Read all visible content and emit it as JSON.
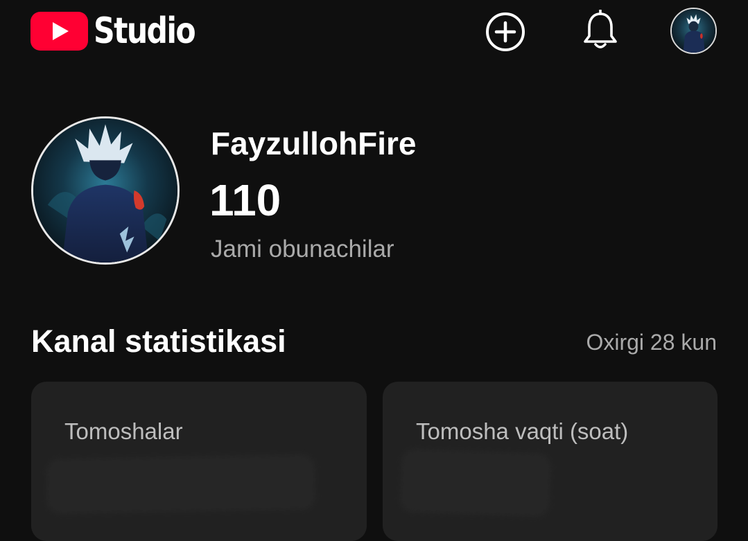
{
  "app": {
    "logo_text": "Studio",
    "logo_icon": "youtube-play-icon",
    "brand_color": "#ff0033",
    "icons": {
      "create": "add-circle-icon",
      "notifications": "bell-icon",
      "account": "avatar"
    }
  },
  "channel": {
    "name": "FayzullohFire",
    "subscriber_count": "110",
    "subscriber_label": "Jami obunachilar"
  },
  "stats": {
    "title": "Kanal statistikasi",
    "period": "Oxirgi 28 kun",
    "cards": [
      {
        "label": "Tomoshalar",
        "value_hidden": true
      },
      {
        "label": "Tomosha vaqti (soat)",
        "value_hidden": true
      }
    ]
  },
  "colors": {
    "background": "#0f0f0f",
    "card": "#212121",
    "secondary_text": "#aaaaaa"
  }
}
